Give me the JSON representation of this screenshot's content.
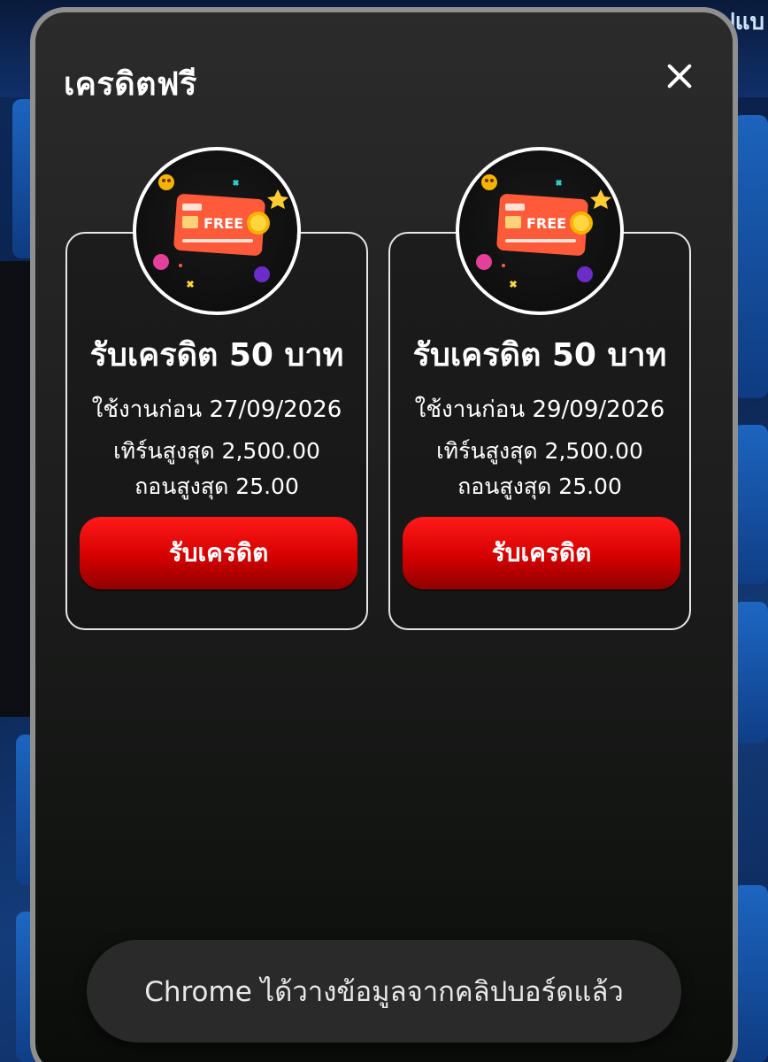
{
  "background": {
    "top_text": "ปแบ"
  },
  "modal": {
    "title": "เครดิตฟรี",
    "close_icon": "close-icon"
  },
  "cards": [
    {
      "badge_text": "FREE",
      "title": "รับเครดิต 50 บาท",
      "expiry": "ใช้งานก่อน 27/09/2026",
      "turnover": "เทิร์นสูงสุด 2,500.00",
      "withdraw": "ถอนสูงสุด 25.00",
      "button_label": "รับเครดิต"
    },
    {
      "badge_text": "FREE",
      "title": "รับเครดิต 50 บาท",
      "expiry": "ใช้งานก่อน 29/09/2026",
      "turnover": "เทิร์นสูงสุด 2,500.00",
      "withdraw": "ถอนสูงสุด 25.00",
      "button_label": "รับเครดิต"
    }
  ],
  "toast": {
    "message": "Chrome ได้วางข้อมูลจากคลิปบอร์ดแล้ว"
  },
  "colors": {
    "button_red": "#e00000",
    "modal_bg": "#1e1e1e",
    "modal_border": "#8f8f8f"
  }
}
